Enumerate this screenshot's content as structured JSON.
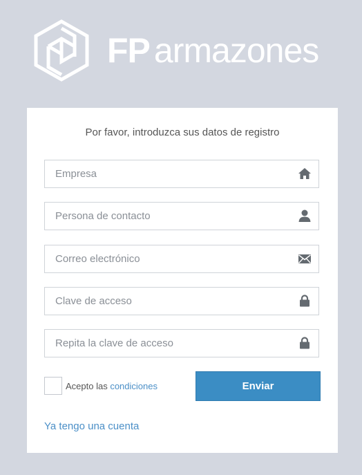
{
  "brand": {
    "prefix": "FP",
    "name": "armazones"
  },
  "form": {
    "intro": "Por favor, introduzca sus datos de registro",
    "fields": [
      {
        "placeholder": "Empresa",
        "value": "",
        "icon": "home-icon"
      },
      {
        "placeholder": "Persona de contacto",
        "value": "",
        "icon": "user-icon"
      },
      {
        "placeholder": "Correo electrónico",
        "value": "",
        "icon": "envelope-icon"
      },
      {
        "placeholder": "Clave de acceso",
        "value": "",
        "icon": "lock-icon"
      },
      {
        "placeholder": "Repita la clave de acceso",
        "value": "",
        "icon": "lock-icon"
      }
    ],
    "accept_prefix": "Acepto las",
    "accept_link": "condiciones",
    "submit_label": "Enviar",
    "login_link": "Ya tengo una cuenta"
  },
  "colors": {
    "background": "#d3d7e0",
    "accent": "#3b8dc4",
    "link": "#4b8fc7",
    "icon": "#646a70"
  }
}
